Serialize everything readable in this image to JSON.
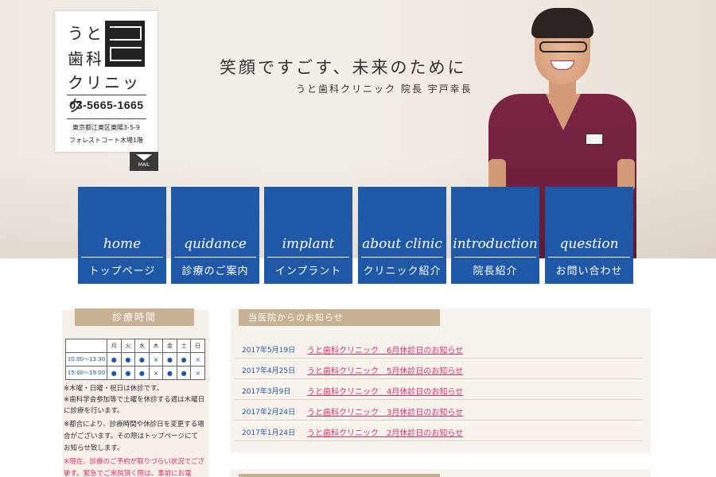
{
  "logo": {
    "line1": "うと",
    "line2": "歯科",
    "line3": "クリニック",
    "phone": "03-5665-1665",
    "address1": "東京都江東区東陽3-5-9",
    "address2": "フォレストコート木場1階",
    "mail_label": "MAIL"
  },
  "hero": {
    "tagline": "笑顔ですごす、未来のために",
    "subtag": "うと歯科クリニック 院長 宇戸幸長"
  },
  "nav": [
    {
      "en": "home",
      "jp": "トップページ"
    },
    {
      "en": "quidance",
      "jp": "診療のご案内"
    },
    {
      "en": "implant",
      "jp": "インプラント"
    },
    {
      "en": "about clinic",
      "jp": "クリニック紹介"
    },
    {
      "en": "introduction",
      "jp": "院長紹介"
    },
    {
      "en": "question",
      "jp": "お問い合わせ"
    }
  ],
  "hours": {
    "title": "診療時間",
    "days": [
      "月",
      "火",
      "水",
      "木",
      "金",
      "土",
      "日"
    ],
    "rows": [
      {
        "time": "10:00〜13:30",
        "marks": [
          "●",
          "●",
          "●",
          "×",
          "●",
          "●",
          "×"
        ]
      },
      {
        "time": "15:00〜19:00",
        "marks": [
          "●",
          "●",
          "●",
          "×",
          "●",
          "●",
          "×"
        ]
      }
    ],
    "notes": [
      "※木曜・日曜・祝日は休診です。",
      "※歯科学会参加等で土曜を休診する週は木曜日",
      "に診療を行います。",
      "※都合により、診療時間や休診日を変更する場",
      "合がございます。その際はトップページにて",
      "お知らせ致します。"
    ],
    "red_notes": [
      "※現在、診療のご予約が取りづらい状況でござい",
      "ます。緊急でご来院頂く際は、事前にお電"
    ]
  },
  "news": {
    "title": "当医院からのお知らせ",
    "items": [
      {
        "date": "2017年5月19日",
        "text": "うと歯科クリニック　6月休診日のお知らせ"
      },
      {
        "date": "2017年4月25日",
        "text": "うと歯科クリニック　5月休診日のお知らせ"
      },
      {
        "date": "2017年3月9日",
        "text": "うと歯科クリニック　4月休診日のお知らせ"
      },
      {
        "date": "2017年2月24日",
        "text": "うと歯科クリニック　3月休診日のお知らせ"
      },
      {
        "date": "2017年1月24日",
        "text": "うと歯科クリニック　2月休診日のお知らせ"
      }
    ]
  },
  "colors": {
    "nav_blue": "#1f58a6",
    "accent_beige": "#c8b192",
    "link_pink": "#d6336c",
    "scrubs": "#7c2644"
  }
}
